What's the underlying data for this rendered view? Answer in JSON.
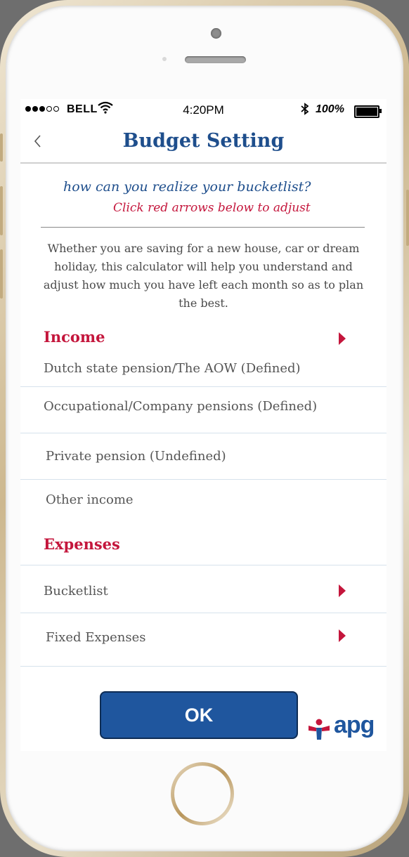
{
  "status_bar": {
    "carrier": "BELL",
    "time": "4:20PM",
    "battery_percent": "100%",
    "signal_bars": 3,
    "signal_total": 5
  },
  "nav": {
    "back_icon": "chevron-left-icon",
    "title": "Budget Setting"
  },
  "header": {
    "question": "how can you realize your bucketlist?",
    "instruction": "Click red arrows below to adjust"
  },
  "intro_text": "Whether you are saving for a new house, car or dream holiday, this calculator will help you understand and adjust how much you have left each month so as to plan the best.",
  "income": {
    "title": "Income",
    "items": [
      "Dutch state pension/The AOW (Defined)",
      "Occupational/Company pensions (Defined)",
      "Private pension (Undefined)",
      "Other income"
    ]
  },
  "expenses": {
    "title": "Expenses",
    "items": [
      "Bucketlist",
      "Fixed Expenses"
    ]
  },
  "ok_label": "OK",
  "logo_text": "apg",
  "colors": {
    "brand_blue": "#1e4e8c",
    "accent_red": "#c4163c",
    "button_blue": "#1f569e"
  }
}
